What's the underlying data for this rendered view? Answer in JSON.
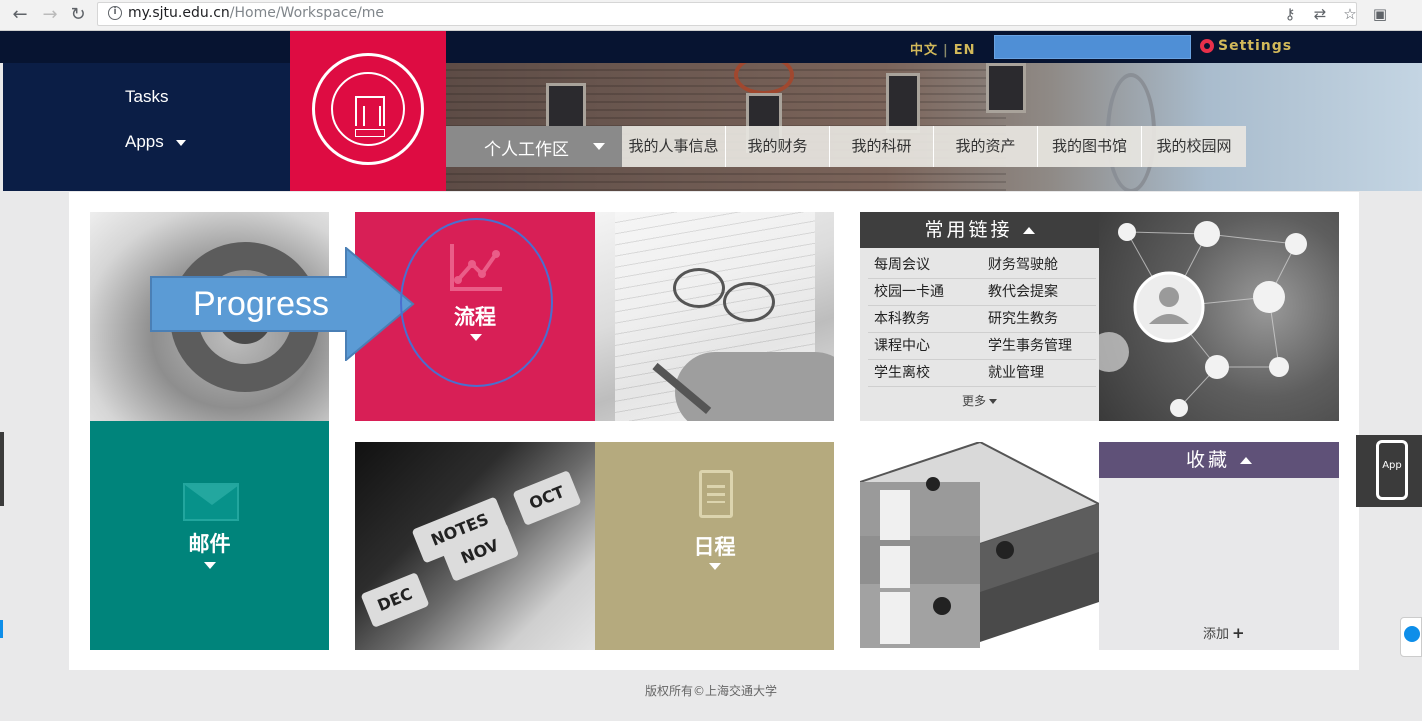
{
  "browser": {
    "url_host": "my.sjtu.edu.cn",
    "url_path": "/Home/Workspace/me"
  },
  "topbar": {
    "lang_zh": "中文",
    "lang_sep": "|",
    "lang_en": "EN",
    "settings_label": "Settings"
  },
  "leftnav": {
    "tasks": "Tasks",
    "apps": "Apps"
  },
  "workspace": {
    "label": "个人工作区",
    "tabs": [
      "我的人事信息",
      "我的财务",
      "我的科研",
      "我的资产",
      "我的图书馆",
      "我的校园网"
    ]
  },
  "tiles": {
    "mail": "邮件",
    "flow": "流程",
    "schedule": "日程",
    "calendar_tabs": [
      "NOTES",
      "NOV",
      "OCT",
      "DEC"
    ]
  },
  "links": {
    "title": "常用链接",
    "items": [
      "每周会议",
      "财务驾驶舱",
      "校园一卡通",
      "教代会提案",
      "本科教务",
      "研究生教务",
      "课程中心",
      "学生事务管理",
      "学生离校",
      "就业管理"
    ],
    "more": "更多"
  },
  "favorites": {
    "title": "收藏",
    "add": "添加"
  },
  "annotation": {
    "arrow_text": "Progress"
  },
  "side": {
    "app_label": "App"
  },
  "footer": {
    "copyright": "版权所有©上海交通大学"
  },
  "colors": {
    "flow_tile": "#d81f56",
    "mail_tile": "#00847b",
    "schedule_tile": "#b5aa7e",
    "favorites_header": "#5f5178",
    "logo_red": "#de0c42",
    "navy": "#0b1e46"
  }
}
